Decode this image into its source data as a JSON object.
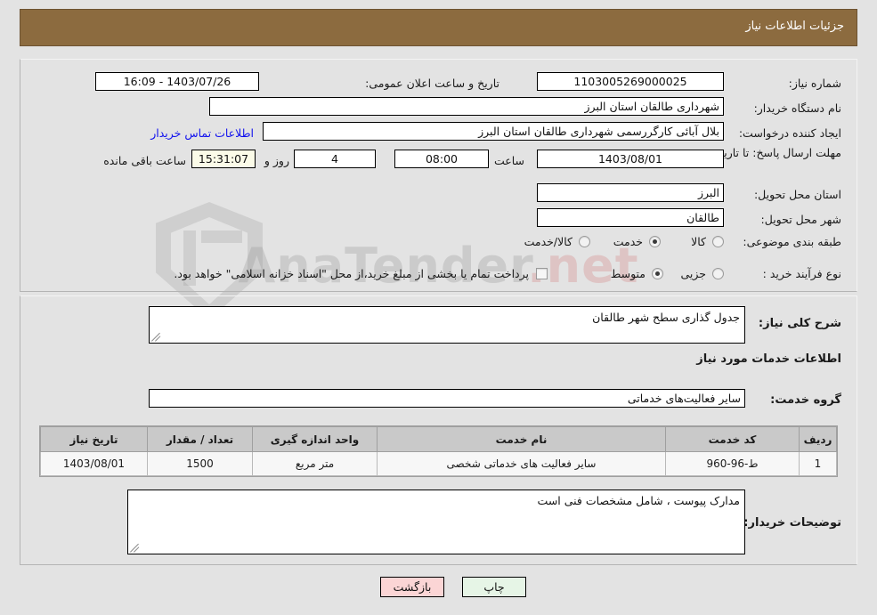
{
  "header": {
    "title": "جزئیات اطلاعات نیاز"
  },
  "watermark": {
    "text": "AnaTender",
    "suffix": ".net"
  },
  "form": {
    "need_number": {
      "label": "شماره نیاز:",
      "value": "1103005269000025"
    },
    "announce_datetime": {
      "label": "تاریخ و ساعت اعلان عمومی:",
      "value": "1403/07/26 - 16:09"
    },
    "buyer_org": {
      "label": "نام دستگاه خریدار:",
      "value": "شهرداری طالقان استان البرز"
    },
    "requester": {
      "label": "ایجاد کننده درخواست:",
      "value": "بلال آبائی کارگررسمی شهرداری طالقان استان البرز"
    },
    "buyer_contact_link": "اطلاعات تماس خریدار",
    "deadline": {
      "label": "مهلت ارسال پاسخ: تا تاریخ:",
      "value": "1403/08/01"
    },
    "deadline_time": {
      "label": "ساعت",
      "value": "08:00"
    },
    "remaining_days": {
      "value": "4"
    },
    "remaining_days_label": "روز و",
    "remaining_time": {
      "value": "15:31:07"
    },
    "remaining_suffix": "ساعت باقی مانده",
    "delivery_province": {
      "label": "استان محل تحویل:",
      "value": "البرز"
    },
    "delivery_city": {
      "label": "شهر محل تحویل:",
      "value": "طالقان"
    },
    "category": {
      "label": "طبقه بندی موضوعی:",
      "options": [
        "کالا",
        "خدمت",
        "کالا/خدمت"
      ],
      "selected": "خدمت"
    },
    "purchase_type": {
      "label": "نوع فرآیند خرید :",
      "options": [
        "جزیی",
        "متوسط"
      ],
      "selected": "متوسط"
    },
    "treasury_checkbox": {
      "checked": false,
      "text": "پرداخت تمام یا بخشی از مبلغ خرید،از محل \"اسناد خزانه اسلامی\" خواهد بود."
    }
  },
  "details": {
    "summary": {
      "label": "شرح کلی نیاز:",
      "value": "جدول گذاری سطح شهر طالقان"
    },
    "section_title": "اطلاعات خدمات مورد نیاز",
    "service_group": {
      "label": "گروه خدمت:",
      "value": "سایر فعالیت‌های خدماتی"
    },
    "table": {
      "headers": [
        "ردیف",
        "کد خدمت",
        "نام خدمت",
        "واحد اندازه گیری",
        "تعداد / مقدار",
        "تاریخ نیاز"
      ],
      "rows": [
        [
          "1",
          "ط-96-960",
          "سایر فعالیت های خدماتی شخصی",
          "متر مربع",
          "1500",
          "1403/08/01"
        ]
      ]
    },
    "buyer_notes": {
      "label": "توضیحات خریدار:",
      "value": "مدارک پیوست ، شامل مشخصات فنی است"
    }
  },
  "footer": {
    "print_label": "چاپ",
    "back_label": "بازگشت"
  }
}
